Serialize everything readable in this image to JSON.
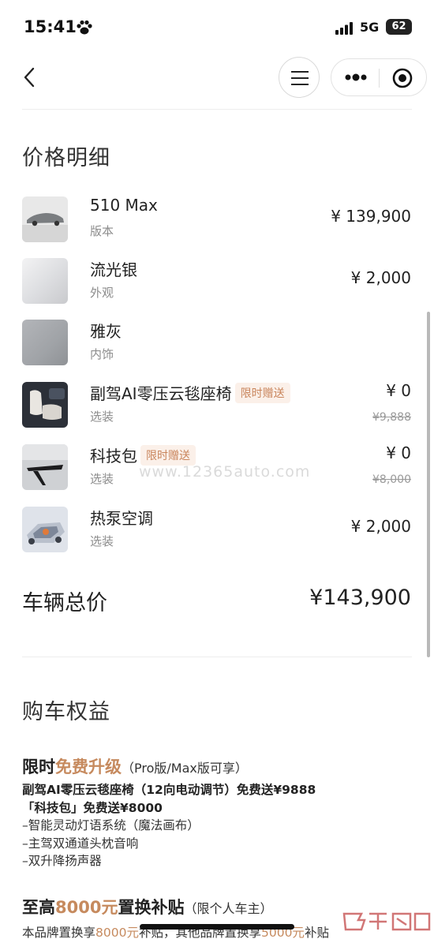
{
  "status_bar": {
    "time": "15:41",
    "network": "5G",
    "battery": "62"
  },
  "title": "价格明细",
  "items": [
    {
      "name": "510 Max",
      "category": "版本",
      "price": "¥ 139,900"
    },
    {
      "name": "流光银",
      "category": "外观",
      "price": "¥ 2,000"
    },
    {
      "name": "雅灰",
      "category": "内饰"
    },
    {
      "name": "副驾AI零压云毯座椅",
      "tag": "限时赠送",
      "category": "选装",
      "price": "¥ 0",
      "original_price": "¥9,888"
    },
    {
      "name": "科技包",
      "tag": "限时赠送",
      "category": "选装",
      "price": "¥ 0",
      "original_price": "¥8,000"
    },
    {
      "name": "热泵空调",
      "category": "选装",
      "price": "¥ 2,000"
    }
  ],
  "total": {
    "label": "车辆总价",
    "value": "¥143,900"
  },
  "benefits": {
    "title": "购车权益",
    "upgrade": {
      "title_a": "限时",
      "title_b": "免费升级",
      "note": "（Pro版/Max版可享）",
      "line1_a": "副驾AI零压云毯座椅（12向电动调节）",
      "line1_b": "免费送¥9888",
      "line2_a": "「科技包」",
      "line2_b": "免费送¥8000",
      "line3": "–智能灵动灯语系统（魔法画布）",
      "line4": "–主驾双通道头枕音响",
      "line5": "–双升降扬声器"
    },
    "tradein": {
      "title_a": "至高",
      "title_b": "8000元",
      "title_c": "置换补贴",
      "note": "（限个人车主）",
      "line_a": "本品牌置换享",
      "line_b": "8000元",
      "line_c": "补贴，其他品牌置换享",
      "line_d": "5000元",
      "line_e": "补贴"
    }
  },
  "watermark": "www.12365auto.com",
  "colors": {
    "accent": "#c68a5e",
    "tag_bg": "#fbf0e9",
    "muted": "#8c8c8c"
  }
}
